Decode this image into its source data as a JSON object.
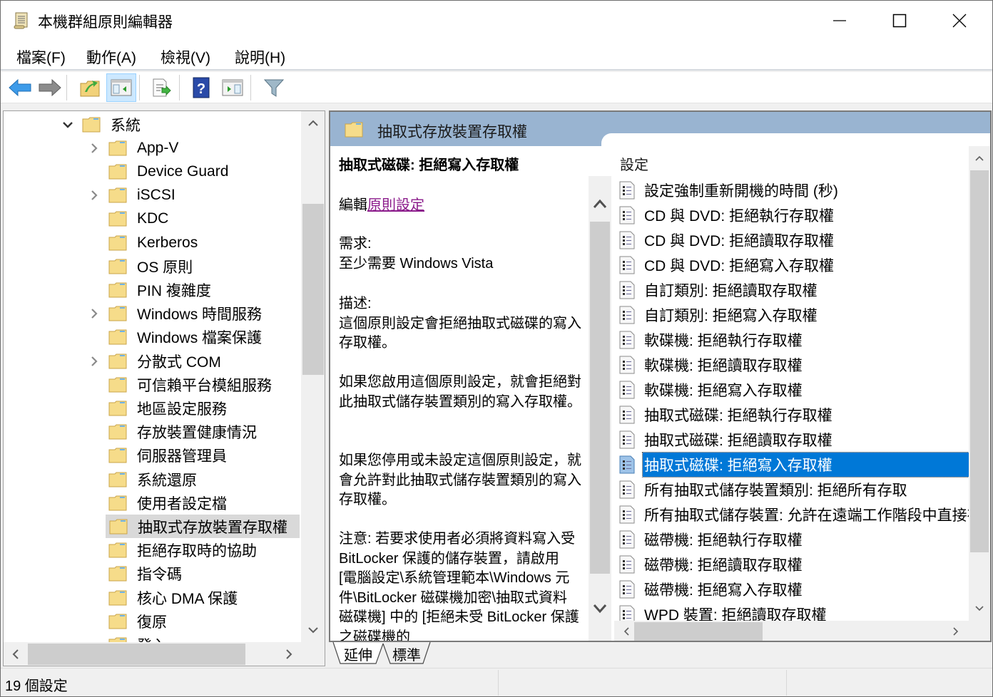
{
  "window": {
    "title": "本機群組原則編輯器",
    "controls": {
      "minimize": "minimize",
      "maximize": "maximize",
      "close": "close"
    }
  },
  "menubar": {
    "items": [
      {
        "label": "檔案(F)"
      },
      {
        "label": "動作(A)"
      },
      {
        "label": "檢視(V)"
      },
      {
        "label": "說明(H)"
      }
    ]
  },
  "toolbar": {
    "buttons": [
      {
        "icon": "back-arrow-icon",
        "tooltip": "上一頁"
      },
      {
        "icon": "forward-arrow-icon",
        "tooltip": "下一頁"
      },
      {
        "icon": "up-folder-icon",
        "tooltip": "上移一層"
      },
      {
        "icon": "show-hide-tree-icon",
        "tooltip": "顯示/隱藏主控台樹狀目錄",
        "active": true
      },
      {
        "icon": "export-list-icon",
        "tooltip": "匯出清單"
      },
      {
        "icon": "help-icon",
        "tooltip": "說明"
      },
      {
        "icon": "show-hide-action-pane-icon",
        "tooltip": "顯示/隱藏動作窗格"
      },
      {
        "icon": "filter-icon",
        "tooltip": "篩選選項"
      }
    ]
  },
  "tree": {
    "parent": {
      "label": "系統",
      "expanded": true
    },
    "items": [
      {
        "label": "App-V",
        "expandable": true
      },
      {
        "label": "Device Guard",
        "expandable": false
      },
      {
        "label": "iSCSI",
        "expandable": true
      },
      {
        "label": "KDC",
        "expandable": false
      },
      {
        "label": "Kerberos",
        "expandable": false
      },
      {
        "label": "OS 原則",
        "expandable": false
      },
      {
        "label": "PIN 複雜度",
        "expandable": false
      },
      {
        "label": "Windows 時間服務",
        "expandable": true
      },
      {
        "label": "Windows 檔案保護",
        "expandable": false
      },
      {
        "label": "分散式 COM",
        "expandable": true
      },
      {
        "label": "可信賴平台模組服務",
        "expandable": false
      },
      {
        "label": "地區設定服務",
        "expandable": false
      },
      {
        "label": "存放裝置健康情況",
        "expandable": false
      },
      {
        "label": "伺服器管理員",
        "expandable": false
      },
      {
        "label": "系統還原",
        "expandable": false
      },
      {
        "label": "使用者設定檔",
        "expandable": false
      },
      {
        "label": "抽取式存放裝置存取權",
        "expandable": false,
        "selected": true
      },
      {
        "label": "拒絕存取時的協助",
        "expandable": false
      },
      {
        "label": "指令碼",
        "expandable": false
      },
      {
        "label": "核心 DMA 保護",
        "expandable": false
      },
      {
        "label": "復原",
        "expandable": false
      },
      {
        "label": "登入",
        "expandable": false
      }
    ]
  },
  "right_pane": {
    "header_title": "抽取式存放裝置存取權",
    "description": {
      "title": "抽取式磁碟: 拒絕寫入存取權",
      "edit_prefix": "編輯",
      "edit_link": "原則設定",
      "requirements_label": "需求:",
      "requirements_value": "至少需要 Windows Vista",
      "description_label": "描述:",
      "paragraphs": [
        "這個原則設定會拒絕抽取式磁碟的寫入存取權。",
        "如果您啟用這個原則設定，就會拒絕對此抽取式儲存裝置類別的寫入存取權。",
        "如果您停用或未設定這個原則設定，就會允許對此抽取式儲存裝置類別的寫入存取權。",
        "注意: 若要求使用者必須將資料寫入受 BitLocker 保護的儲存裝置，請啟用 [電腦設定\\系統管理範本\\Windows 元件\\BitLocker 磁碟機加密\\抽取式資料磁碟機] 中的 [拒絕未受 BitLocker 保護之磁碟機的"
      ]
    },
    "settings_header": "設定",
    "settings": [
      {
        "label": "設定強制重新開機的時間 (秒)"
      },
      {
        "label": "CD 與 DVD: 拒絕執行存取權"
      },
      {
        "label": "CD 與 DVD: 拒絕讀取存取權"
      },
      {
        "label": "CD 與 DVD: 拒絕寫入存取權"
      },
      {
        "label": "自訂類別: 拒絕讀取存取權"
      },
      {
        "label": "自訂類別: 拒絕寫入存取權"
      },
      {
        "label": "軟碟機: 拒絕執行存取權"
      },
      {
        "label": "軟碟機: 拒絕讀取存取權"
      },
      {
        "label": "軟碟機: 拒絕寫入存取權"
      },
      {
        "label": "抽取式磁碟: 拒絕執行存取權"
      },
      {
        "label": "抽取式磁碟: 拒絕讀取存取權"
      },
      {
        "label": "抽取式磁碟: 拒絕寫入存取權",
        "selected": true
      },
      {
        "label": "所有抽取式儲存裝置類別: 拒絕所有存取"
      },
      {
        "label": "所有抽取式儲存裝置: 允許在遠端工作階段中直接存取"
      },
      {
        "label": "磁帶機: 拒絕執行存取權"
      },
      {
        "label": "磁帶機: 拒絕讀取存取權"
      },
      {
        "label": "磁帶機: 拒絕寫入存取權"
      },
      {
        "label": "WPD 裝置: 拒絕讀取存取權"
      }
    ]
  },
  "bottom_tabs": [
    {
      "label": "延伸",
      "active": true
    },
    {
      "label": "標準",
      "active": false
    }
  ],
  "statusbar": {
    "text": "19 個設定"
  },
  "colors": {
    "selection": "#0078d7",
    "header_bar": "#99b4d1",
    "tree_selected": "#d9d9d9",
    "link": "#8b1b8b"
  }
}
